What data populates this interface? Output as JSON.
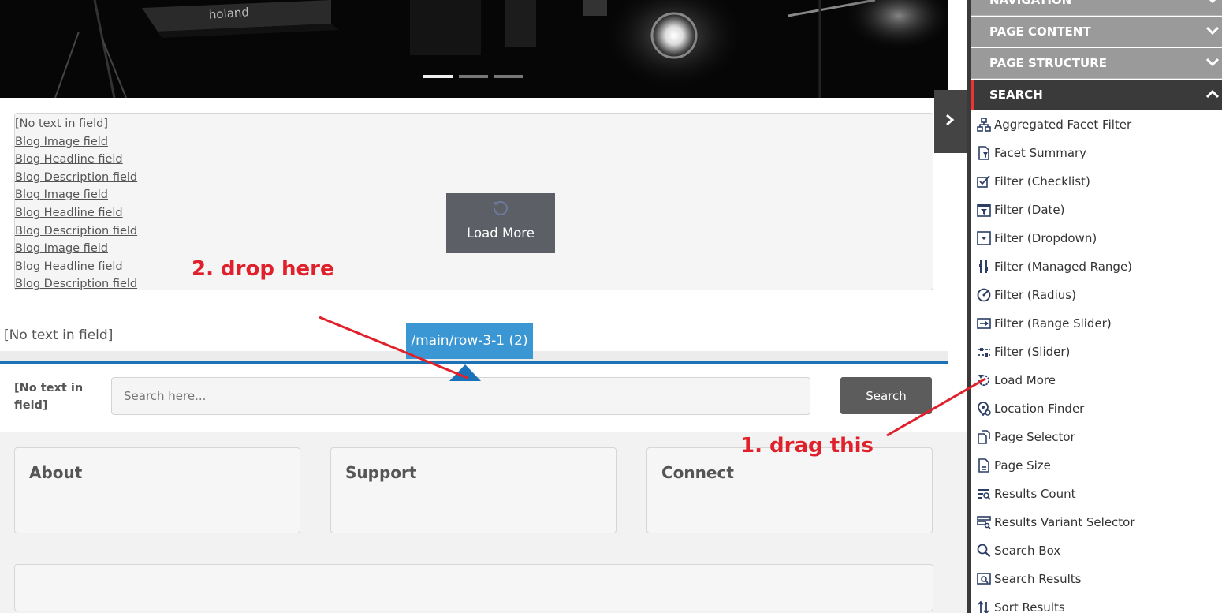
{
  "hero": {
    "slides": [
      "slide-1",
      "slide-2",
      "slide-3"
    ],
    "active_slide": 1,
    "graffiti_text": "holand"
  },
  "blog_list": {
    "empty_text": "[No text in field]",
    "links": [
      "Blog Image field",
      "Blog Headline field",
      "Blog Description field",
      "Blog Image field",
      "Blog Headline field",
      "Blog Description field",
      "Blog Image field",
      "Blog Headline field",
      "Blog Description field"
    ],
    "load_more_label": "Load More"
  },
  "empty_field_text": "[No text in field]",
  "placeholder": {
    "path_label": "/main/row-3-1 (2)"
  },
  "search": {
    "label": "[No text in field]",
    "placeholder": "Search here...",
    "button_label": "Search"
  },
  "footer": {
    "cards": [
      "About",
      "Support",
      "Connect"
    ]
  },
  "annotations": {
    "drop": "2. drop here",
    "drag": "1. drag this",
    "color": "#e0202a"
  },
  "sidebar": {
    "sections": [
      {
        "label": "NAVIGATION",
        "expanded": false
      },
      {
        "label": "PAGE CONTENT",
        "expanded": false
      },
      {
        "label": "PAGE STRUCTURE",
        "expanded": false
      },
      {
        "label": "SEARCH",
        "expanded": true
      }
    ],
    "items": [
      {
        "label": "Aggregated Facet Filter",
        "icon": "hierarchy-icon"
      },
      {
        "label": "Facet Summary",
        "icon": "document-filter-icon"
      },
      {
        "label": "Filter (Checklist)",
        "icon": "checkbox-icon"
      },
      {
        "label": "Filter (Date)",
        "icon": "calendar-filter-icon"
      },
      {
        "label": "Filter (Dropdown)",
        "icon": "dropdown-icon"
      },
      {
        "label": "Filter (Managed Range)",
        "icon": "range-sliders-icon"
      },
      {
        "label": "Filter (Radius)",
        "icon": "radius-icon"
      },
      {
        "label": "Filter (Range Slider)",
        "icon": "range-slider-icon"
      },
      {
        "label": "Filter (Slider)",
        "icon": "slider-icon"
      },
      {
        "label": "Load More",
        "icon": "load-more-icon"
      },
      {
        "label": "Location Finder",
        "icon": "location-pin-icon"
      },
      {
        "label": "Page Selector",
        "icon": "page-selector-icon"
      },
      {
        "label": "Page Size",
        "icon": "page-size-icon"
      },
      {
        "label": "Results Count",
        "icon": "results-count-icon"
      },
      {
        "label": "Results Variant Selector",
        "icon": "variant-selector-icon"
      },
      {
        "label": "Search Box",
        "icon": "search-icon"
      },
      {
        "label": "Search Results",
        "icon": "search-results-icon"
      },
      {
        "label": "Sort Results",
        "icon": "sort-icon"
      }
    ],
    "active_color": "#e33333"
  },
  "colors": {
    "placeholder_blue": "#1b72b8",
    "tag_blue": "#3b97d3",
    "sidebar_dark": "#3a3a3a"
  }
}
